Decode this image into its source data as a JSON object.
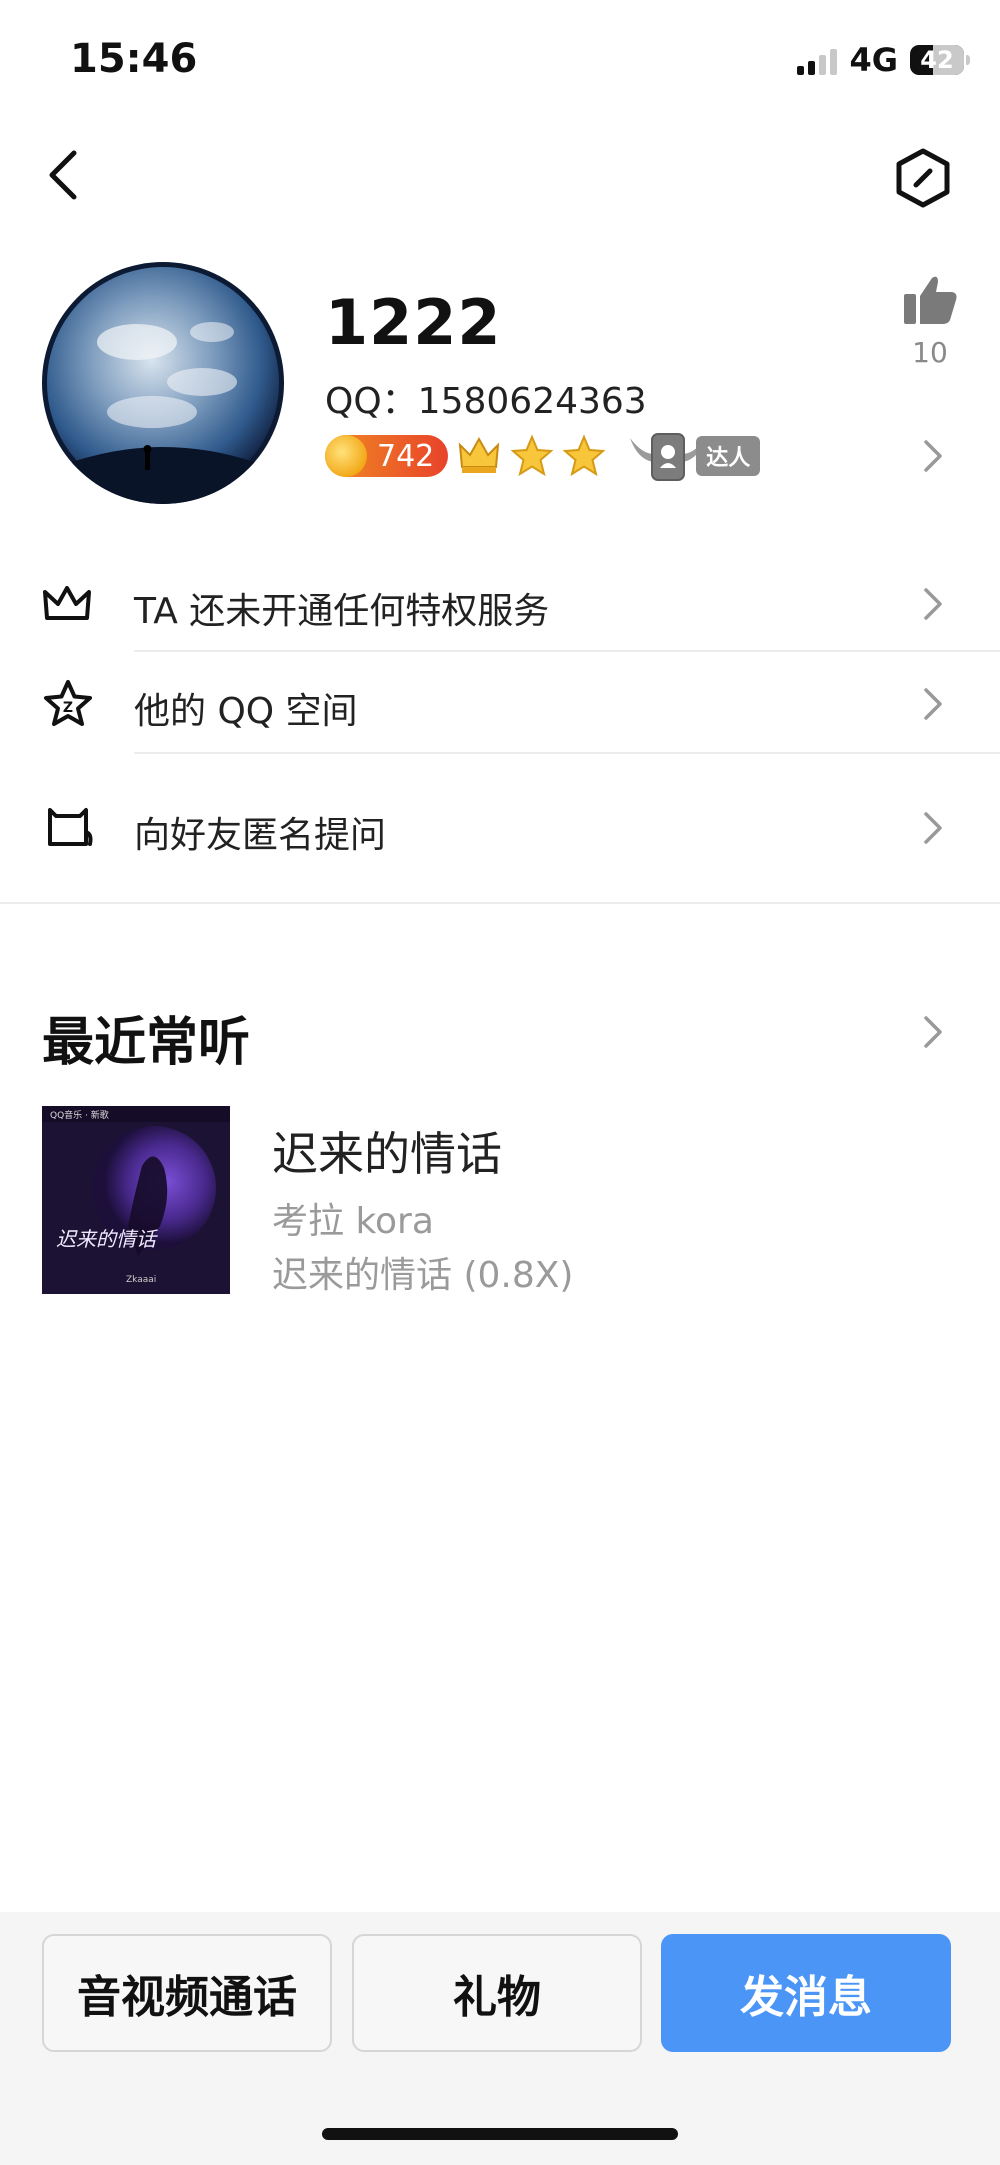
{
  "status_bar": {
    "time": "15:46",
    "network": "4G",
    "battery": "42",
    "battery_level": 0.42
  },
  "profile": {
    "nickname": "1222",
    "qq_label": "QQ：1580624363",
    "level": "742",
    "daren_label": "达人",
    "likes": "10"
  },
  "menu": [
    {
      "label": "TA 还未开通任何特权服务",
      "icon": "crown-icon"
    },
    {
      "label": "他的 QQ 空间",
      "icon": "star-space-icon"
    },
    {
      "label": "向好友匿名提问",
      "icon": "question-box-icon"
    }
  ],
  "recent": {
    "title": "最近常听",
    "song": {
      "title": "迟来的情话",
      "artist": "考拉 kora",
      "album": "迟来的情话 (0.8X)",
      "cover_header": "QQ音乐 · 新歌",
      "cover_title": "迟来的情话",
      "cover_artist": "Zkaaai"
    }
  },
  "actions": {
    "call": "音视频通话",
    "gift": "礼物",
    "message": "发消息"
  },
  "colors": {
    "primary": "#4a95f5",
    "level_pill": "#e8432a",
    "muted_text": "#9a9a9a"
  }
}
